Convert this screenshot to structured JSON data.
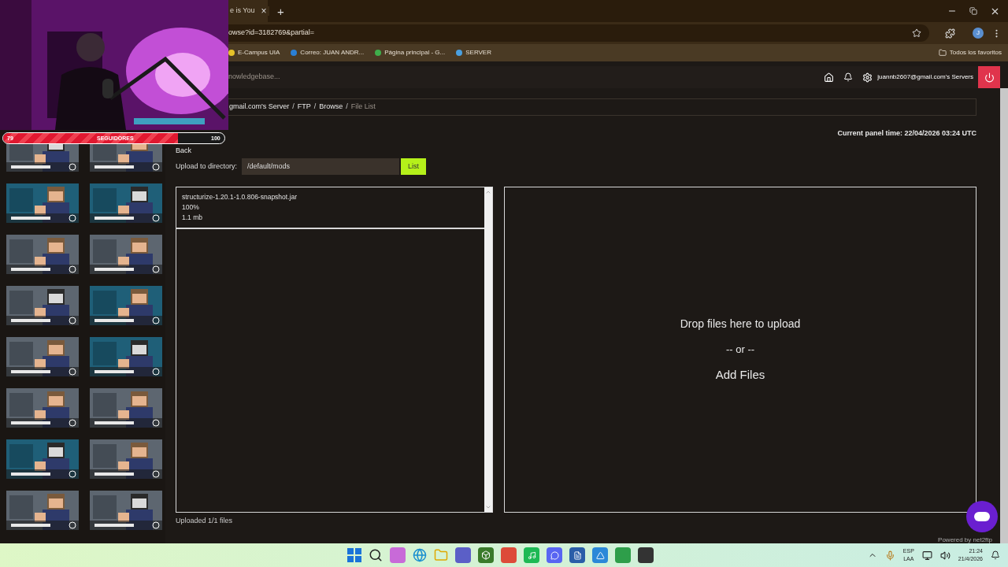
{
  "follower_goal": {
    "current": "79",
    "label": "SEGUIDORES",
    "max": "100",
    "level": 0.79
  },
  "browser": {
    "tab": {
      "title": "e is You",
      "close": "×"
    },
    "new_tab": "+",
    "address": "owse?id=3182769&partial=",
    "avatar": "J",
    "bookmarks": [
      "E-Campus UIA",
      "Correo: JUAN ANDR...",
      "Página principal - G...",
      "SERVER"
    ],
    "all_bookmarks": "Todos los favoritos"
  },
  "header": {
    "search_placeholder": "nowledgebase...",
    "account": "juannb2607@gmail.com's Servers"
  },
  "breadcrumb": [
    {
      "kind": "link",
      "label": "gmail.com's Server",
      "current": false
    },
    {
      "kind": "separator",
      "label": "/"
    },
    {
      "kind": "link",
      "label": "FTP",
      "current": false
    },
    {
      "kind": "separator",
      "label": "/"
    },
    {
      "kind": "link",
      "label": "Browse",
      "current": false
    },
    {
      "kind": "separator",
      "label": "/"
    },
    {
      "kind": "link",
      "label": "File List",
      "current": true
    }
  ],
  "panel_time": "Current panel time: 22/04/2026 03:24 UTC",
  "back": "Back",
  "upload": {
    "label": "Upload to directory:",
    "directory": "/default/mods",
    "button": "List"
  },
  "queue": [
    {
      "name": "structurize-1.20.1-1.0.806-snapshot.jar",
      "progress": "100%",
      "size": "1.1 mb"
    }
  ],
  "dropzone": {
    "text": "Drop files here to upload",
    "or": "-- or --",
    "button": "Add Files"
  },
  "status": "Uploaded 1/1 files",
  "powered_by": "Powered by net2ftp",
  "taskbar": {
    "language": "ESP",
    "layout": "LAA",
    "time": "21:24",
    "date": "21/4/2026"
  }
}
